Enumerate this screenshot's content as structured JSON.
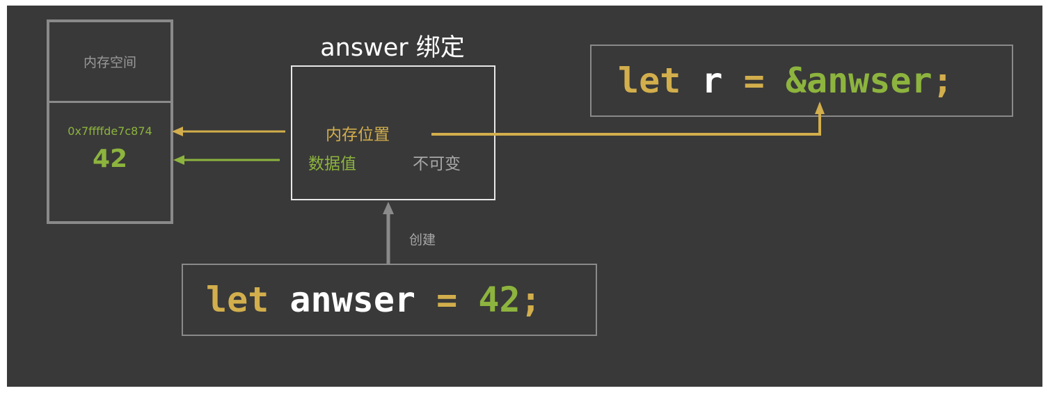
{
  "memory": {
    "header": "内存空间",
    "address": "0x7ffffde7c874",
    "value": "42"
  },
  "binding": {
    "title": "answer 绑定",
    "location_label": "内存位置",
    "value_label": "数据值",
    "mutability_label": "不可变"
  },
  "create_label": "创建",
  "code_ref": {
    "keyword": "let",
    "name": "r",
    "op": "=",
    "value": "&anwser",
    "semicolon": ";"
  },
  "code_decl": {
    "keyword": "let",
    "name": "anwser",
    "op": "=",
    "value": "42",
    "semicolon": ";"
  },
  "colors": {
    "background": "#393939",
    "yellow": "#d2ae4c",
    "green": "#8db43e",
    "gray": "#8a8a8a",
    "white": "#ffffff"
  }
}
